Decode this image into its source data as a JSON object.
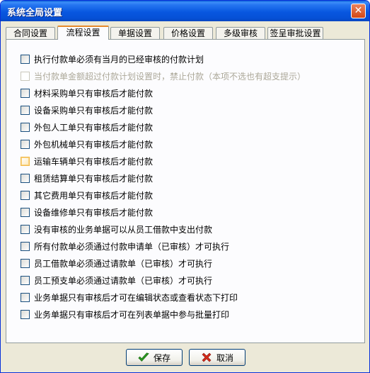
{
  "window": {
    "title": "系统全局设置"
  },
  "tabs": [
    {
      "label": "合同设置"
    },
    {
      "label": "流程设置"
    },
    {
      "label": "单据设置"
    },
    {
      "label": "价格设置"
    },
    {
      "label": "多级审核"
    },
    {
      "label": "签呈审批设置"
    }
  ],
  "options": [
    {
      "label": "执行付款单必须有当月的已经审核的付款计划"
    },
    {
      "label": "当付款单金额超过付款计划设置时，禁止付款（本项不选也有超支提示）"
    },
    {
      "label": "材料采购单只有审核后才能付款"
    },
    {
      "label": "设备采购单只有审核后才能付款"
    },
    {
      "label": "外包人工单只有审核后才能付款"
    },
    {
      "label": "外包机械单只有审核后才能付款"
    },
    {
      "label": "运输车辆单只有审核后才能付款"
    },
    {
      "label": "租赁结算单只有审核后才能付款"
    },
    {
      "label": "其它费用单只有审核后才能付款"
    },
    {
      "label": "设备维修单只有审核后才能付款"
    },
    {
      "label": "没有审核的业务单据可以从员工借款中支出付款"
    },
    {
      "label": "所有付款单必须通过付款申请单（已审核）才可执行"
    },
    {
      "label": "员工借款单必须通过请款单（已审核）才可执行"
    },
    {
      "label": "员工预支单必须通过请款单（已审核）才可执行"
    },
    {
      "label": "业务单据只有审核后才可在编辑状态或查看状态下打印"
    },
    {
      "label": "业务单据只有审核后才可在列表单据中参与批量打印"
    }
  ],
  "buttons": {
    "save": "保存",
    "cancel": "取消"
  },
  "colors": {
    "title_bar": "#0857e0",
    "active_tab_accent": "#e68b2c",
    "save_icon": "#2a9a20",
    "cancel_icon": "#d42a1a"
  }
}
